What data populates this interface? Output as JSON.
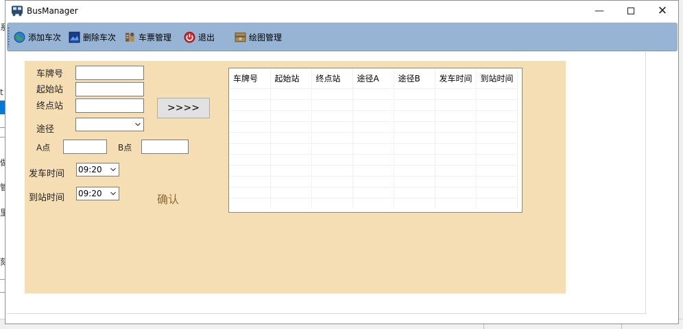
{
  "window": {
    "title": "BusManager",
    "buttons": {
      "minimize": "—",
      "close": "✕"
    }
  },
  "toolbar": {
    "items": [
      {
        "label": "添加车次",
        "icon": "globe-icon"
      },
      {
        "label": "删除车次",
        "icon": "picture-icon"
      },
      {
        "label": "车票管理",
        "icon": "tools-icon"
      },
      {
        "label": "退出",
        "icon": "power-icon"
      },
      {
        "label": "绘图管理",
        "icon": "package-icon"
      }
    ]
  },
  "form": {
    "plate_label": "车牌号",
    "start_label": "起始站",
    "end_label": "终点站",
    "route_label": "途径",
    "point_a_label": "A点",
    "point_b_label": "B点",
    "depart_label": "发车时间",
    "arrive_label": "到站时间",
    "depart_time": "09:20",
    "arrive_time": "09:20",
    "transfer_button": ">>>>",
    "confirm": "确认"
  },
  "grid": {
    "columns": [
      "车牌号",
      "起始站",
      "终点站",
      "途径A",
      "途径B",
      "发车时间",
      "到站时间"
    ],
    "empty_rows": 11
  },
  "background_window": {
    "fragments": [
      "系",
      "t",
      "做",
      "管",
      "里",
      "刻"
    ]
  }
}
